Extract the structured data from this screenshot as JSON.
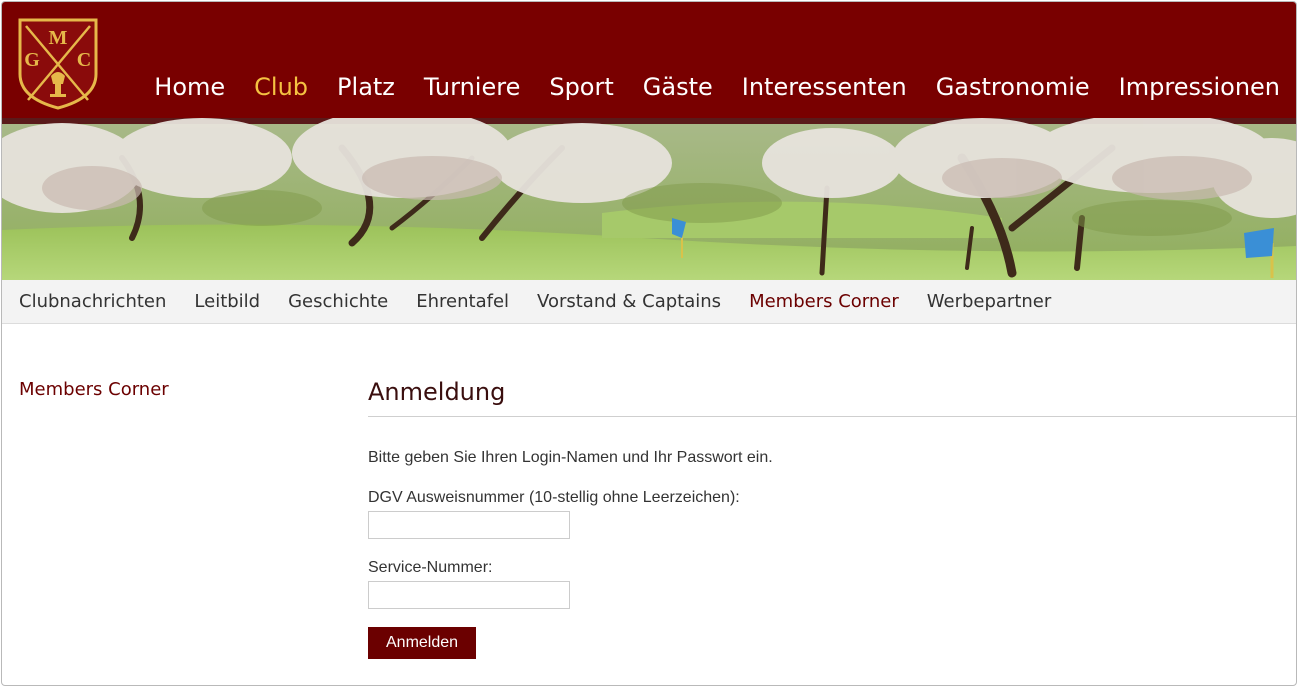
{
  "logo": {
    "letters": [
      "G",
      "M",
      "C"
    ]
  },
  "main_nav": [
    {
      "label": "Home",
      "active": false
    },
    {
      "label": "Club",
      "active": true
    },
    {
      "label": "Platz",
      "active": false
    },
    {
      "label": "Turniere",
      "active": false
    },
    {
      "label": "Sport",
      "active": false
    },
    {
      "label": "Gäste",
      "active": false
    },
    {
      "label": "Interessenten",
      "active": false
    },
    {
      "label": "Gastronomie",
      "active": false
    },
    {
      "label": "Impressionen",
      "active": false
    }
  ],
  "sub_nav": [
    {
      "label": "Clubnachrichten",
      "active": false
    },
    {
      "label": "Leitbild",
      "active": false
    },
    {
      "label": "Geschichte",
      "active": false
    },
    {
      "label": "Ehrentafel",
      "active": false
    },
    {
      "label": "Vorstand & Captains",
      "active": false
    },
    {
      "label": "Members Corner",
      "active": true
    },
    {
      "label": "Werbepartner",
      "active": false
    }
  ],
  "sidebar": {
    "title": "Members Corner"
  },
  "login": {
    "heading": "Anmeldung",
    "intro": "Bitte geben Sie Ihren Login-Namen und Ihr Passwort ein.",
    "field1_label": "DGV Ausweisnummer (10-stellig ohne Leerzeichen):",
    "field1_value": "",
    "field2_label": "Service-Nummer:",
    "field2_value": "",
    "submit_label": "Anmelden"
  },
  "colors": {
    "header_bg": "#790000",
    "nav_active": "#f5c242",
    "accent": "#6b0000"
  },
  "icons": [
    "golf-club-crest-icon",
    "golf-flag-icon"
  ]
}
